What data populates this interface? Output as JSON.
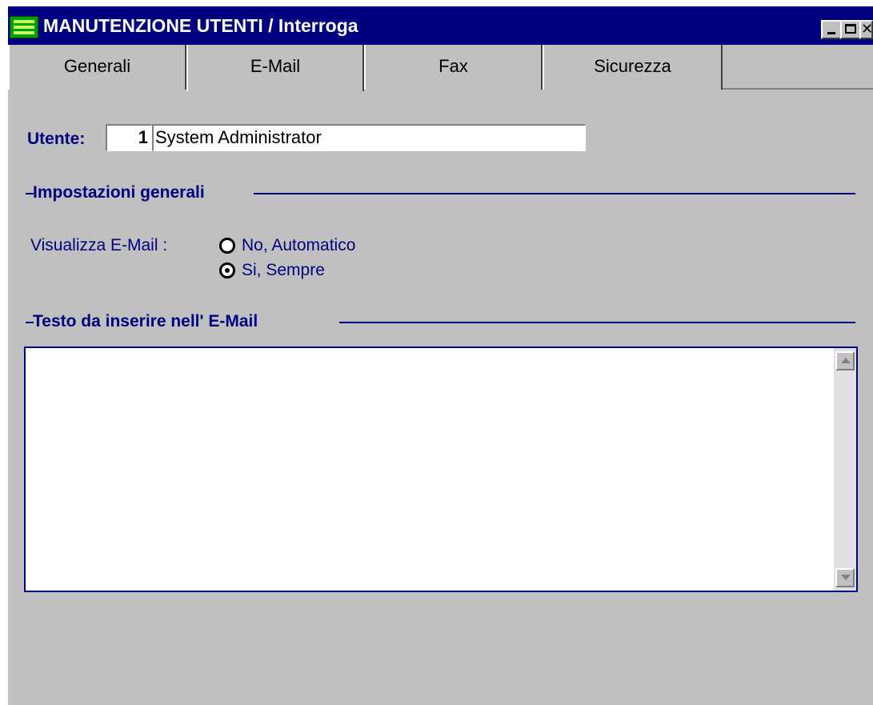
{
  "window": {
    "title": "MANUTENZIONE UTENTI / Interroga",
    "icon": "app-icon",
    "controls": [
      "minimize-icon",
      "maximize-icon",
      "close-icon"
    ]
  },
  "tabs": [
    {
      "label": "Generali",
      "active": false
    },
    {
      "label": "E-Mail",
      "active": true
    },
    {
      "label": "Fax",
      "active": false
    },
    {
      "label": "Sicurezza",
      "active": false
    }
  ],
  "user": {
    "label": "Utente:",
    "number": "1",
    "name": "System Administrator"
  },
  "general_settings": {
    "title": "Impostazioni generali",
    "view_email_label": "Visualizza E-Mail :",
    "options": [
      {
        "label": "No, Automatico",
        "selected": false
      },
      {
        "label": "Si, Sempre",
        "selected": true
      }
    ]
  },
  "email_text": {
    "title": "Testo da inserire nell' E-Mail",
    "value": ""
  },
  "colors": {
    "titlebar": "#000080",
    "window_bg": "#c0c0c0",
    "label_text": "#000080"
  }
}
